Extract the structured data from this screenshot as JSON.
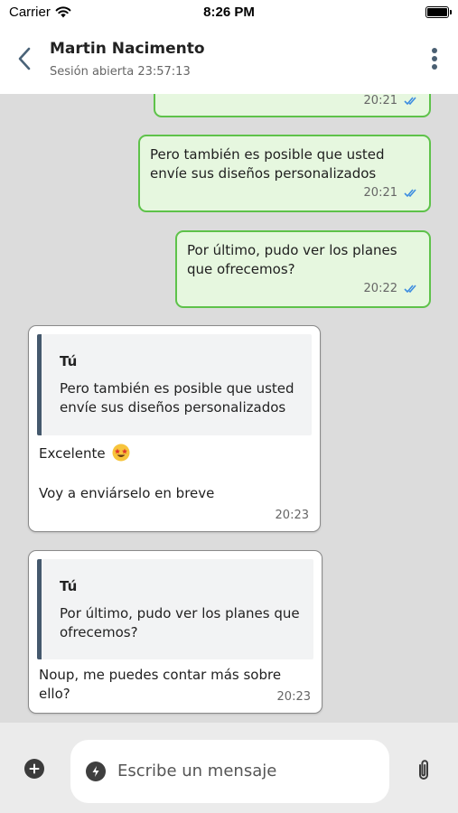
{
  "status_bar": {
    "carrier": "Carrier",
    "time": "8:26 PM"
  },
  "header": {
    "contact_name": "Martin Nacimento",
    "session_text": "Sesión abierta 23:57:13"
  },
  "messages": [
    {
      "direction": "outgoing",
      "text": "",
      "time": "20:21",
      "status": "read",
      "partial": true
    },
    {
      "direction": "outgoing",
      "text": "Pero también es posible que usted envíe sus diseños personalizados",
      "time": "20:21",
      "status": "read"
    },
    {
      "direction": "outgoing",
      "text": "Por último, pudo ver los planes que ofrecemos?",
      "time": "20:22",
      "status": "read"
    },
    {
      "direction": "incoming",
      "quote": {
        "author": "Tú",
        "text": "Pero también es posible que usted envíe sus diseños personalizados"
      },
      "text": "Excelente",
      "emoji": "star-struck",
      "text2": "Voy a enviárselo en breve",
      "time": "20:23"
    },
    {
      "direction": "incoming",
      "quote": {
        "author": "Tú",
        "text": "Por último, pudo ver los planes que ofrecemos?"
      },
      "text": "Noup, me puedes contar más sobre ello?",
      "time": "20:23"
    }
  ],
  "composer": {
    "placeholder": "Escribe un mensaje"
  },
  "colors": {
    "outgoing_bg": "#e6f7df",
    "outgoing_border": "#5ec24a",
    "read_tick": "#3d8de0",
    "quote_bar": "#45596d",
    "chat_bg": "#dcdcdc"
  }
}
